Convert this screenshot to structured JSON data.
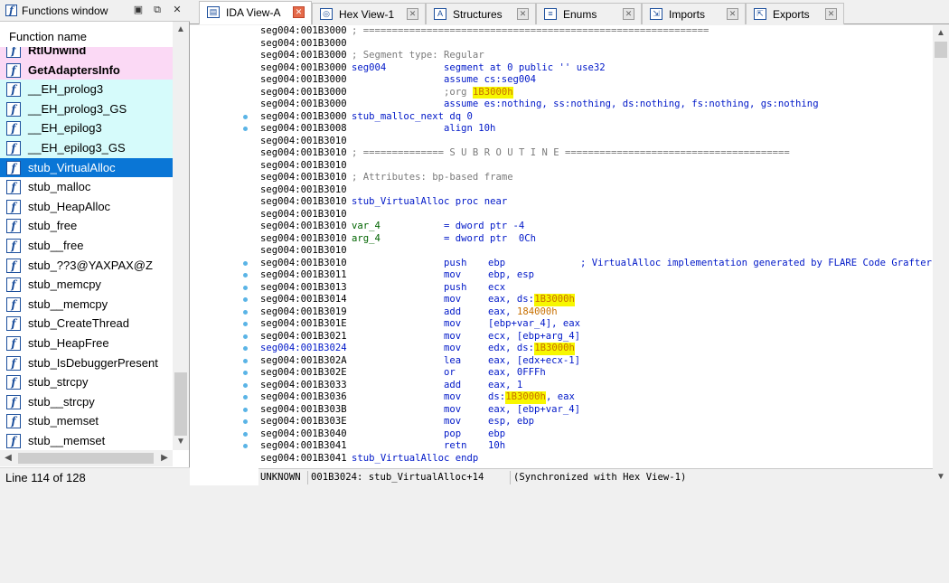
{
  "functions_window": {
    "title": "Functions window",
    "header": "Function name",
    "status": "Line 114 of 128",
    "items": [
      {
        "label": "RtlUnwind",
        "style": "pink bold"
      },
      {
        "label": "GetAdaptersInfo",
        "style": "pink bold"
      },
      {
        "label": "__EH_prolog3",
        "style": "cyan"
      },
      {
        "label": "__EH_prolog3_GS",
        "style": "cyan"
      },
      {
        "label": "__EH_epilog3",
        "style": "cyan"
      },
      {
        "label": "__EH_epilog3_GS",
        "style": "cyan"
      },
      {
        "label": "stub_VirtualAlloc",
        "style": "sel"
      },
      {
        "label": "stub_malloc",
        "style": ""
      },
      {
        "label": "stub_HeapAlloc",
        "style": ""
      },
      {
        "label": "stub_free",
        "style": ""
      },
      {
        "label": "stub__free",
        "style": ""
      },
      {
        "label": "stub_??3@YAXPAX@Z",
        "style": ""
      },
      {
        "label": "stub_memcpy",
        "style": ""
      },
      {
        "label": "stub__memcpy",
        "style": ""
      },
      {
        "label": "stub_CreateThread",
        "style": ""
      },
      {
        "label": "stub_HeapFree",
        "style": ""
      },
      {
        "label": "stub_IsDebuggerPresent",
        "style": ""
      },
      {
        "label": "stub_strcpy",
        "style": ""
      },
      {
        "label": "stub__strcpy",
        "style": ""
      },
      {
        "label": "stub_memset",
        "style": ""
      },
      {
        "label": "stub__memset",
        "style": ""
      }
    ]
  },
  "tabs": [
    {
      "label": "IDA View-A",
      "icon": "ida-view-icon",
      "glyph": "▤",
      "active": true
    },
    {
      "label": "Hex View-1",
      "icon": "hex-view-icon",
      "glyph": "◎",
      "active": false
    },
    {
      "label": "Structures",
      "icon": "structures-icon",
      "glyph": "A",
      "active": false
    },
    {
      "label": "Enums",
      "icon": "enums-icon",
      "glyph": "≡",
      "active": false
    },
    {
      "label": "Imports",
      "icon": "imports-icon",
      "glyph": "⇲",
      "active": false
    },
    {
      "label": "Exports",
      "icon": "exports-icon",
      "glyph": "⇱",
      "active": false
    }
  ],
  "disasm": {
    "lines": [
      {
        "a": "seg004:001B3000",
        "p": [
          {
            "c": "c1",
            "t": "; ============================================================",
            "k": "gray"
          }
        ]
      },
      {
        "a": "seg004:001B3000"
      },
      {
        "a": "seg004:001B3000",
        "p": [
          {
            "c": "c1",
            "t": "; Segment type: Regular",
            "k": "gray"
          }
        ]
      },
      {
        "a": "seg004:001B3000",
        "p": [
          {
            "c": "c1",
            "t": "seg004",
            "k": "dblue"
          },
          {
            "c": "c2",
            "t": "segment at 0 public '' use32",
            "k": "dblue"
          }
        ]
      },
      {
        "a": "seg004:001B3000",
        "p": [
          {
            "c": "c2",
            "t": "assume cs:seg004",
            "k": "dblue"
          }
        ]
      },
      {
        "a": "seg004:001B3000",
        "p": [
          {
            "c": "c2",
            "t": ";org ",
            "k": "gray"
          },
          {
            "c": "c2x",
            "t": "1B3000h",
            "k": "orange hl"
          }
        ]
      },
      {
        "a": "seg004:001B3000",
        "p": [
          {
            "c": "c2",
            "t": "assume es:nothing, ss:nothing, ds:nothing, fs:nothing, gs:nothing",
            "k": "dblue"
          }
        ]
      },
      {
        "a": "seg004:001B3000",
        "dot": true,
        "p": [
          {
            "c": "c1",
            "t": "stub_malloc_next dq 0",
            "k": "dblue"
          }
        ]
      },
      {
        "a": "seg004:001B3008",
        "dot": true,
        "p": [
          {
            "c": "c2",
            "t": "align 10h",
            "k": "dblue"
          }
        ]
      },
      {
        "a": "seg004:001B3010"
      },
      {
        "a": "seg004:001B3010",
        "p": [
          {
            "c": "c1",
            "t": "; ============== S U B R O U T I N E =======================================",
            "k": "gray"
          }
        ]
      },
      {
        "a": "seg004:001B3010"
      },
      {
        "a": "seg004:001B3010",
        "p": [
          {
            "c": "c1",
            "t": "; Attributes: bp-based frame",
            "k": "gray"
          }
        ]
      },
      {
        "a": "seg004:001B3010"
      },
      {
        "a": "seg004:001B3010",
        "p": [
          {
            "c": "c1",
            "t": "stub_VirtualAlloc proc near",
            "k": "dblue"
          }
        ]
      },
      {
        "a": "seg004:001B3010"
      },
      {
        "a": "seg004:001B3010",
        "p": [
          {
            "c": "c1",
            "t": "var_4",
            "k": "green"
          },
          {
            "c": "c2",
            "t": "= dword ptr -4",
            "k": "dblue"
          }
        ]
      },
      {
        "a": "seg004:001B3010",
        "p": [
          {
            "c": "c1",
            "t": "arg_4",
            "k": "green"
          },
          {
            "c": "c2",
            "t": "= dword ptr  0Ch",
            "k": "dblue"
          }
        ]
      },
      {
        "a": "seg004:001B3010"
      },
      {
        "a": "seg004:001B3010",
        "dot": true,
        "p": [
          {
            "c": "c2",
            "t": "push",
            "k": "dblue"
          },
          {
            "c": "c3",
            "t": "ebp",
            "k": "dblue"
          },
          {
            "c": "c4",
            "t": "; VirtualAlloc implementation generated by FLARE Code Grafter",
            "k": "dblue"
          }
        ]
      },
      {
        "a": "seg004:001B3011",
        "dot": true,
        "p": [
          {
            "c": "c2",
            "t": "mov",
            "k": "dblue"
          },
          {
            "c": "c3",
            "t": "ebp, esp",
            "k": "dblue"
          }
        ]
      },
      {
        "a": "seg004:001B3013",
        "dot": true,
        "p": [
          {
            "c": "c2",
            "t": "push",
            "k": "dblue"
          },
          {
            "c": "c3",
            "t": "ecx",
            "k": "dblue"
          }
        ]
      },
      {
        "a": "seg004:001B3014",
        "dot": true,
        "p": [
          {
            "c": "c2",
            "t": "mov",
            "k": "dblue"
          },
          {
            "c": "c3",
            "t": "eax, ds:",
            "k": "dblue"
          },
          {
            "c": "c3x",
            "t": "1B3000h",
            "k": "orange hl"
          }
        ]
      },
      {
        "a": "seg004:001B3019",
        "dot": true,
        "p": [
          {
            "c": "c2",
            "t": "add",
            "k": "dblue"
          },
          {
            "c": "c3",
            "t": "eax, ",
            "k": "dblue"
          },
          {
            "c": "c3y",
            "t": "184000h",
            "k": "orange"
          }
        ]
      },
      {
        "a": "seg004:001B301E",
        "dot": true,
        "p": [
          {
            "c": "c2",
            "t": "mov",
            "k": "dblue"
          },
          {
            "c": "c3",
            "t": "[ebp+var_4], eax",
            "k": "dblue"
          }
        ]
      },
      {
        "a": "seg004:001B3021",
        "dot": true,
        "p": [
          {
            "c": "c2",
            "t": "mov",
            "k": "dblue"
          },
          {
            "c": "c3",
            "t": "ecx, [ebp+arg_4]",
            "k": "dblue"
          }
        ]
      },
      {
        "a": "seg004:001B3024",
        "blue": true,
        "dot": true,
        "p": [
          {
            "c": "c2",
            "t": "mov",
            "k": "dblue"
          },
          {
            "c": "c3",
            "t": "edx, ds:",
            "k": "dblue"
          },
          {
            "c": "c3x",
            "t": "1B3000h",
            "k": "orange hl"
          }
        ]
      },
      {
        "a": "seg004:001B302A",
        "dot": true,
        "p": [
          {
            "c": "c2",
            "t": "lea",
            "k": "dblue"
          },
          {
            "c": "c3",
            "t": "eax, [edx+ecx-1]",
            "k": "dblue"
          }
        ]
      },
      {
        "a": "seg004:001B302E",
        "dot": true,
        "p": [
          {
            "c": "c2",
            "t": "or",
            "k": "dblue"
          },
          {
            "c": "c3",
            "t": "eax, 0FFFh",
            "k": "dblue"
          }
        ]
      },
      {
        "a": "seg004:001B3033",
        "dot": true,
        "p": [
          {
            "c": "c2",
            "t": "add",
            "k": "dblue"
          },
          {
            "c": "c3",
            "t": "eax, 1",
            "k": "dblue"
          }
        ]
      },
      {
        "a": "seg004:001B3036",
        "dot": true,
        "p": [
          {
            "c": "c2",
            "t": "mov",
            "k": "dblue"
          },
          {
            "c": "c3",
            "t": "ds:",
            "k": "dblue"
          },
          {
            "c": "c3z",
            "t": "1B3000h",
            "k": "orange hl"
          },
          {
            "c": "c3w",
            "t": ", eax",
            "k": "dblue"
          }
        ]
      },
      {
        "a": "seg004:001B303B",
        "dot": true,
        "p": [
          {
            "c": "c2",
            "t": "mov",
            "k": "dblue"
          },
          {
            "c": "c3",
            "t": "eax, [ebp+var_4]",
            "k": "dblue"
          }
        ]
      },
      {
        "a": "seg004:001B303E",
        "dot": true,
        "p": [
          {
            "c": "c2",
            "t": "mov",
            "k": "dblue"
          },
          {
            "c": "c3",
            "t": "esp, ebp",
            "k": "dblue"
          }
        ]
      },
      {
        "a": "seg004:001B3040",
        "dot": true,
        "p": [
          {
            "c": "c2",
            "t": "pop",
            "k": "dblue"
          },
          {
            "c": "c3",
            "t": "ebp",
            "k": "dblue"
          }
        ]
      },
      {
        "a": "seg004:001B3041",
        "dot": true,
        "p": [
          {
            "c": "c2",
            "t": "retn",
            "k": "dblue"
          },
          {
            "c": "c3",
            "t": "10h",
            "k": "dblue"
          }
        ]
      },
      {
        "a": "seg004:001B3041",
        "p": [
          {
            "c": "c1",
            "t": "stub_VirtualAlloc endp",
            "k": "dblue"
          }
        ]
      }
    ]
  },
  "status": {
    "mode": "UNKNOWN",
    "location": "001B3024: stub_VirtualAlloc+14",
    "sync": "(Synchronized with Hex View-1)"
  }
}
